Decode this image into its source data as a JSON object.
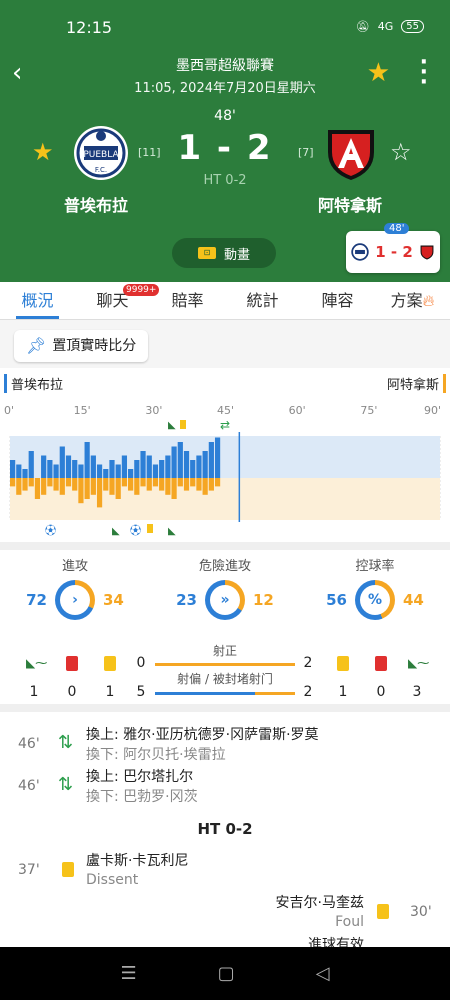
{
  "status": {
    "time": "12:15",
    "signal": "4G",
    "battery": "55"
  },
  "header": {
    "league": "墨西哥超級聯賽",
    "datetime": "11:05, 2024年7月20日星期六",
    "minute": "48'",
    "score": "1 - 2",
    "ht": "HT 0-2",
    "home": {
      "name": "普埃布拉",
      "rank": "[11]"
    },
    "away": {
      "name": "阿特拿斯",
      "rank": "[7]"
    },
    "animation_label": "動畫",
    "mini": {
      "minute": "48'",
      "score": "1 - 2"
    }
  },
  "tabs": [
    {
      "label": "概況",
      "active": true
    },
    {
      "label": "聊天",
      "badge": "9999+"
    },
    {
      "label": "賠率"
    },
    {
      "label": "統計"
    },
    {
      "label": "陣容"
    },
    {
      "label": "方案"
    }
  ],
  "pin_label": "置頂實時比分",
  "timeline": {
    "home": "普埃布拉",
    "away": "阿特拿斯",
    "ticks": [
      "0'",
      "15'",
      "30'",
      "45'",
      "60'",
      "75'",
      "90'"
    ],
    "current_minute": 48,
    "home_pressure": [
      4,
      3,
      2,
      6,
      0,
      5,
      4,
      3,
      7,
      5,
      4,
      3,
      8,
      5,
      3,
      2,
      4,
      3,
      5,
      2,
      4,
      6,
      5,
      3,
      4,
      5,
      7,
      8,
      6,
      4,
      5,
      6,
      8,
      9,
      0,
      0,
      0
    ],
    "away_pressure": [
      2,
      4,
      3,
      2,
      5,
      4,
      2,
      3,
      4,
      2,
      3,
      6,
      5,
      4,
      7,
      3,
      4,
      5,
      2,
      3,
      4,
      2,
      3,
      2,
      3,
      4,
      5,
      2,
      3,
      2,
      3,
      4,
      3,
      2,
      0,
      0,
      0
    ]
  },
  "stats": {
    "attack": {
      "label": "進攻",
      "home": "72",
      "away": "34",
      "home_pct": 68
    },
    "danger": {
      "label": "危險進攻",
      "home": "23",
      "away": "12",
      "home_pct": 66
    },
    "possession": {
      "label": "控球率",
      "home": "56",
      "away": "44",
      "home_pct": 56
    },
    "shots_on": {
      "label": "射正",
      "home": "0",
      "away": "2"
    },
    "shots_off": {
      "label": "射偏 / 被封堵射门",
      "home": "5",
      "away": "2"
    },
    "home_counts": {
      "corners": "1",
      "red": "0",
      "yellow": "1"
    },
    "away_counts": {
      "yellow": "1",
      "red": "0",
      "corners": "3"
    }
  },
  "events": [
    {
      "min": "46'",
      "in": "換上: 雅尔·亚历杭德罗·冈萨雷斯·罗莫",
      "out": "換下: 阿尔贝托·埃雷拉"
    },
    {
      "min": "46'",
      "in": "換上: 巴尔塔扎尔",
      "out": "換下: 巴勃罗·冈茨"
    },
    {
      "ht": "HT 0-2"
    },
    {
      "min": "37'",
      "player": "盧卡斯·卡瓦利尼",
      "reason": "Dissent"
    },
    {
      "min": "30'",
      "player": "安吉尔·马奎兹",
      "reason": "Foul",
      "extra": "進球有效"
    }
  ]
}
